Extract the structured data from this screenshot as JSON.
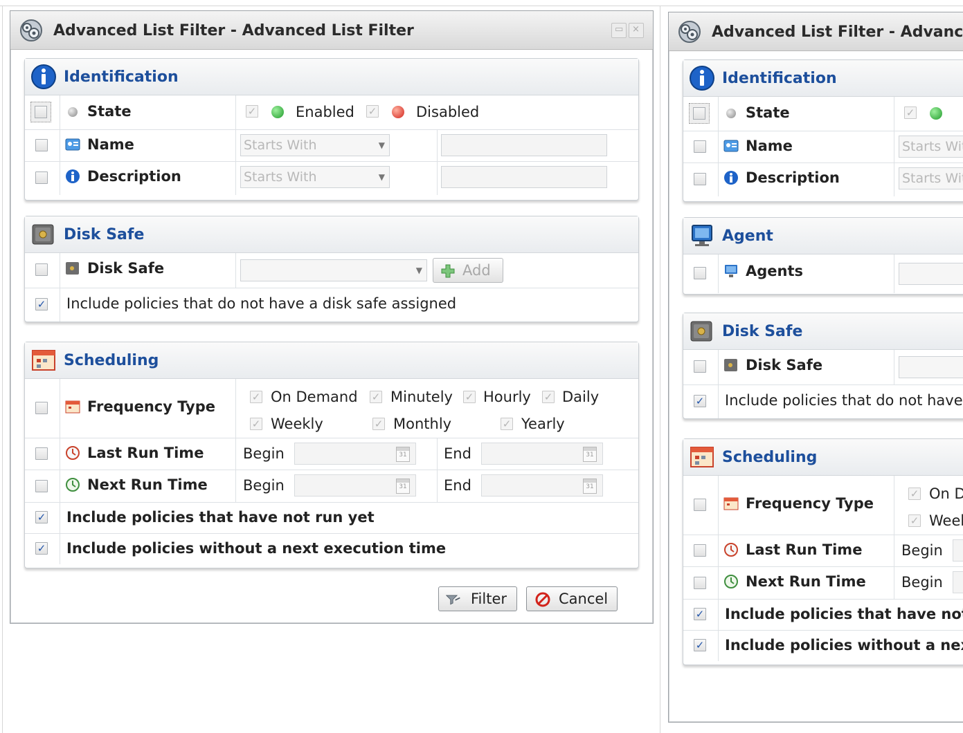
{
  "window_left": {
    "title": "Advanced List Filter - Advanced List Filter",
    "identification": {
      "title": "Identification",
      "state_label": "State",
      "enabled_label": "Enabled",
      "disabled_label": "Disabled",
      "name_label": "Name",
      "name_operator": "Starts With",
      "description_label": "Description",
      "description_operator": "Starts With"
    },
    "disk_safe": {
      "title": "Disk Safe",
      "disk_safe_label": "Disk Safe",
      "add_label": "Add",
      "include_unassigned": "Include policies that do not have a disk safe assigned"
    },
    "scheduling": {
      "title": "Scheduling",
      "frequency_type_label": "Frequency Type",
      "freq_on_demand": "On Demand",
      "freq_minutely": "Minutely",
      "freq_hourly": "Hourly",
      "freq_daily": "Daily",
      "freq_weekly": "Weekly",
      "freq_monthly": "Monthly",
      "freq_yearly": "Yearly",
      "last_run_label": "Last Run Time",
      "next_run_label": "Next Run Time",
      "begin": "Begin",
      "end": "End",
      "include_not_run": "Include policies that have not run yet",
      "include_no_next": "Include policies without a next execution time"
    },
    "buttons": {
      "filter": "Filter",
      "cancel": "Cancel"
    }
  },
  "window_right": {
    "title": "Advanced List Filter - Advanced List Filter",
    "identification": {
      "title": "Identification",
      "state_label": "State",
      "name_label": "Name",
      "name_operator": "Starts With",
      "description_label": "Description",
      "description_operator": "Starts With"
    },
    "agent": {
      "title": "Agent",
      "agents_label": "Agents"
    },
    "disk_safe": {
      "title": "Disk Safe",
      "disk_safe_label": "Disk Safe",
      "include_unassigned": "Include policies that do not have a disk safe assigned"
    },
    "scheduling": {
      "title": "Scheduling",
      "frequency_type_label": "Frequency Type",
      "freq_on_demand": "On Demand",
      "freq_weekly": "Weekly",
      "last_run_label": "Last Run Time",
      "next_run_label": "Next Run Time",
      "begin": "Begin",
      "include_not_run": "Include policies that have not run yet",
      "include_no_next": "Include policies without a next execution time"
    }
  },
  "colors": {
    "section_title": "#1d4f9c",
    "enabled_dot": "#1f9a2a",
    "disabled_dot": "#d2231b",
    "checkbox_check": "#2255aa"
  },
  "icons": {
    "window": "gear-icon",
    "identification": "info-icon",
    "disk_safe": "safe-icon",
    "agent": "monitor-icon",
    "scheduling": "calendar-icon",
    "filter_button": "filter-icon",
    "cancel_button": "cancel-icon",
    "add_button": "plus-icon",
    "date_picker": "calendar-picker-icon"
  }
}
